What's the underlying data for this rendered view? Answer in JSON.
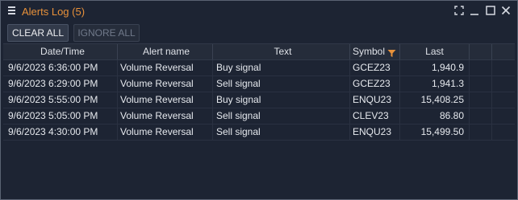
{
  "window": {
    "title": "Alerts Log (5)",
    "title_color": "#e8913a"
  },
  "controls": {
    "icons": [
      "expand-icon",
      "minimize-icon",
      "maximize-icon",
      "close-icon"
    ]
  },
  "toolbar": {
    "clear_label": "CLEAR ALL",
    "ignore_label": "IGNORE ALL"
  },
  "table": {
    "columns": [
      "Date/Time",
      "Alert name",
      "Text",
      "Symbol",
      "Last"
    ],
    "symbol_filter_active": true,
    "rows": [
      {
        "datetime": "9/6/2023 6:36:00 PM",
        "alert": "Volume Reversal",
        "text": "Buy signal",
        "symbol": "GCEZ23",
        "last": "1,940.9"
      },
      {
        "datetime": "9/6/2023 6:29:00 PM",
        "alert": "Volume Reversal",
        "text": "Sell signal",
        "symbol": "GCEZ23",
        "last": "1,941.3"
      },
      {
        "datetime": "9/6/2023 5:55:00 PM",
        "alert": "Volume Reversal",
        "text": "Buy signal",
        "symbol": "ENQU23",
        "last": "15,408.25"
      },
      {
        "datetime": "9/6/2023 5:05:00 PM",
        "alert": "Volume Reversal",
        "text": "Sell signal",
        "symbol": "CLEV23",
        "last": "86.80"
      },
      {
        "datetime": "9/6/2023 4:30:00 PM",
        "alert": "Volume Reversal",
        "text": "Sell signal",
        "symbol": "ENQU23",
        "last": "15,499.50"
      }
    ]
  }
}
